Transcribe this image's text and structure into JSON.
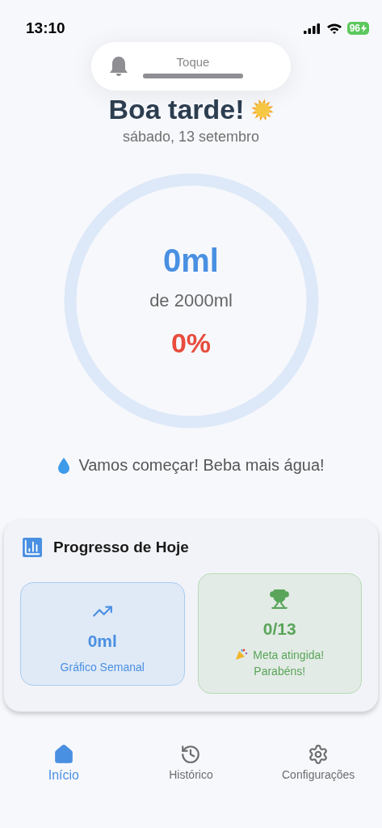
{
  "status_bar": {
    "time": "13:10",
    "battery": "96"
  },
  "toast": {
    "label": "Toque",
    "level": 1
  },
  "greeting": "Boa tarde!",
  "date": "sábado, 13 setembro",
  "ring": {
    "amount": "0ml",
    "goal": "de 2000ml",
    "percent": "0%"
  },
  "message": "Vamos começar! Beba mais água!",
  "progress_card": {
    "title": "Progresso de Hoje",
    "tiles": [
      {
        "kind": "weekly",
        "value": "0ml",
        "caption": "Gráfico Semanal"
      },
      {
        "kind": "goal",
        "value": "0/13",
        "caption": "Meta atingida! Parabéns!"
      }
    ]
  },
  "nav": [
    {
      "label": "Início",
      "kind": "home",
      "selected": true
    },
    {
      "label": "Histórico",
      "kind": "history",
      "selected": false
    },
    {
      "label": "Configurações",
      "kind": "settings",
      "selected": false
    }
  ]
}
